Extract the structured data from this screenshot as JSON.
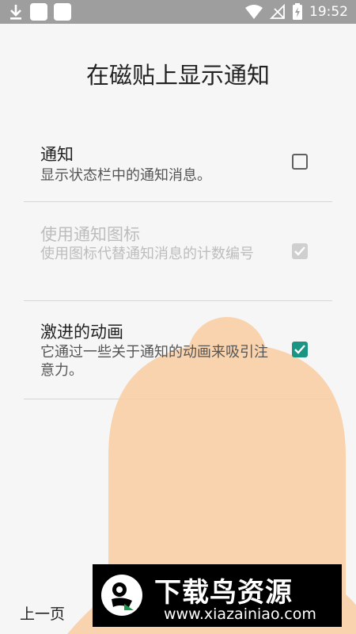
{
  "status_bar": {
    "time": "19:52",
    "icons": [
      "download-icon",
      "app-square-icon",
      "app-square-icon",
      "wifi-icon",
      "no-signal-icon",
      "battery-charging-icon"
    ]
  },
  "page": {
    "title": "在磁贴上显示通知"
  },
  "settings": [
    {
      "title": "通知",
      "subtitle": "显示状态栏中的通知消息。",
      "checked": false,
      "enabled": true
    },
    {
      "title": "使用通知图标",
      "subtitle": "使用图标代替通知消息的计数编号",
      "checked": true,
      "enabled": false
    },
    {
      "title": "激进的动画",
      "subtitle": "它通过一些关于通知的动画来吸引注意力。",
      "checked": true,
      "enabled": true
    }
  ],
  "nav": {
    "prev_label": "上一页"
  },
  "watermark": {
    "title": "下载鸟资源",
    "url": "www.xiazainiao.com"
  },
  "colors": {
    "accent": "#1a9483",
    "bell": "#f9d3ad",
    "status_bar": "#9e9e9e"
  }
}
